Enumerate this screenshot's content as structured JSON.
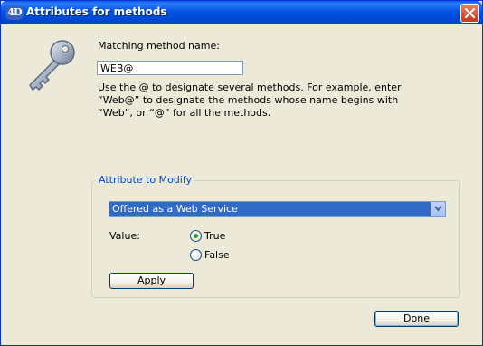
{
  "window": {
    "title": "Attributes for methods",
    "app_logo": "4D",
    "close_icon": "close-icon"
  },
  "form": {
    "matching_label": "Matching method name:",
    "name_value": "WEB@",
    "help_text": "Use the @ to designate several methods. For example, enter “Web@” to designate the methods whose name begins with “Web”, or “@” for all the methods."
  },
  "attribute_group": {
    "legend": "Attribute to Modify",
    "selected_attribute": "Offered as a Web Service",
    "value_label": "Value:",
    "options": [
      {
        "label": "True",
        "checked": true
      },
      {
        "label": "False",
        "checked": false
      }
    ],
    "apply_label": "Apply"
  },
  "footer": {
    "done_label": "Done"
  },
  "colors": {
    "titlebar": "#0054E3",
    "legend_text": "#0046D5",
    "selection": "#316AC5",
    "dialog_bg": "#ECE9D8"
  }
}
